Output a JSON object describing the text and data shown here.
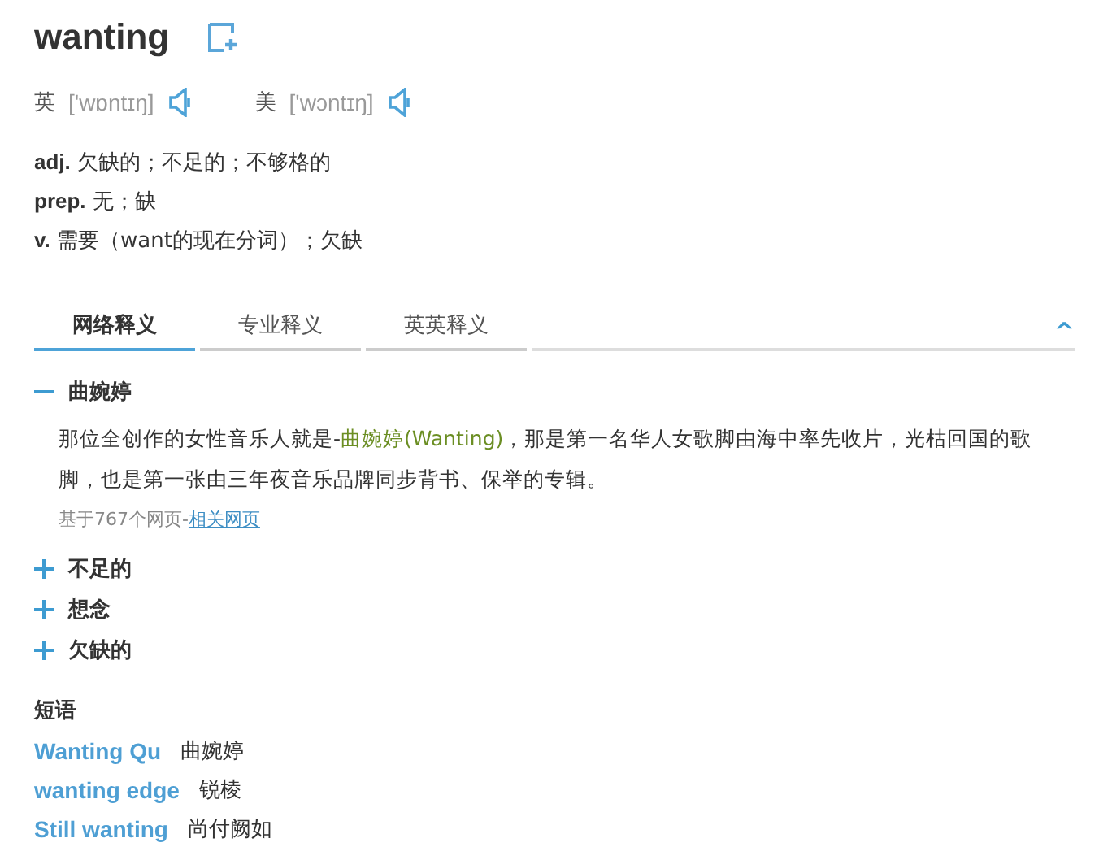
{
  "word": "wanting",
  "pronunciations": [
    {
      "label": "英",
      "phonetic": "['wɒntɪŋ]"
    },
    {
      "label": "美",
      "phonetic": "['wɔntɪŋ]"
    }
  ],
  "definitions": [
    {
      "pos": "adj.",
      "meaning": "欠缺的；不足的；不够格的"
    },
    {
      "pos": "prep.",
      "meaning": "无；缺"
    },
    {
      "pos": "v.",
      "meaning": "需要（want的现在分词）；欠缺"
    }
  ],
  "tabs": [
    {
      "label": "网络释义",
      "selected": true
    },
    {
      "label": "专业释义",
      "selected": false
    },
    {
      "label": "英英释义",
      "selected": false
    }
  ],
  "collapse_toggle": "^",
  "senses": [
    {
      "term": "曲婉婷",
      "expanded": true,
      "example": {
        "before": "那位全创作的女性音乐人就是-",
        "highlight": "曲婉婷(Wanting)",
        "after": "，那是第一名华人女歌脚由海中率先收片，光枯回国的歌脚，也是第一张由三年夜音乐品牌同步背书、保举的专辑。"
      },
      "source": "基于767个网页-",
      "source_link": "相关网页"
    },
    {
      "term": "不足的",
      "expanded": false
    },
    {
      "term": "想念",
      "expanded": false
    },
    {
      "term": "欠缺的",
      "expanded": false
    }
  ],
  "phrases_heading": "短语",
  "phrases": [
    {
      "phrase": "Wanting Qu",
      "meaning": "曲婉婷"
    },
    {
      "phrase": "wanting edge",
      "meaning": "锐棱"
    },
    {
      "phrase": "Still wanting",
      "meaning": "尚付阙如"
    }
  ]
}
